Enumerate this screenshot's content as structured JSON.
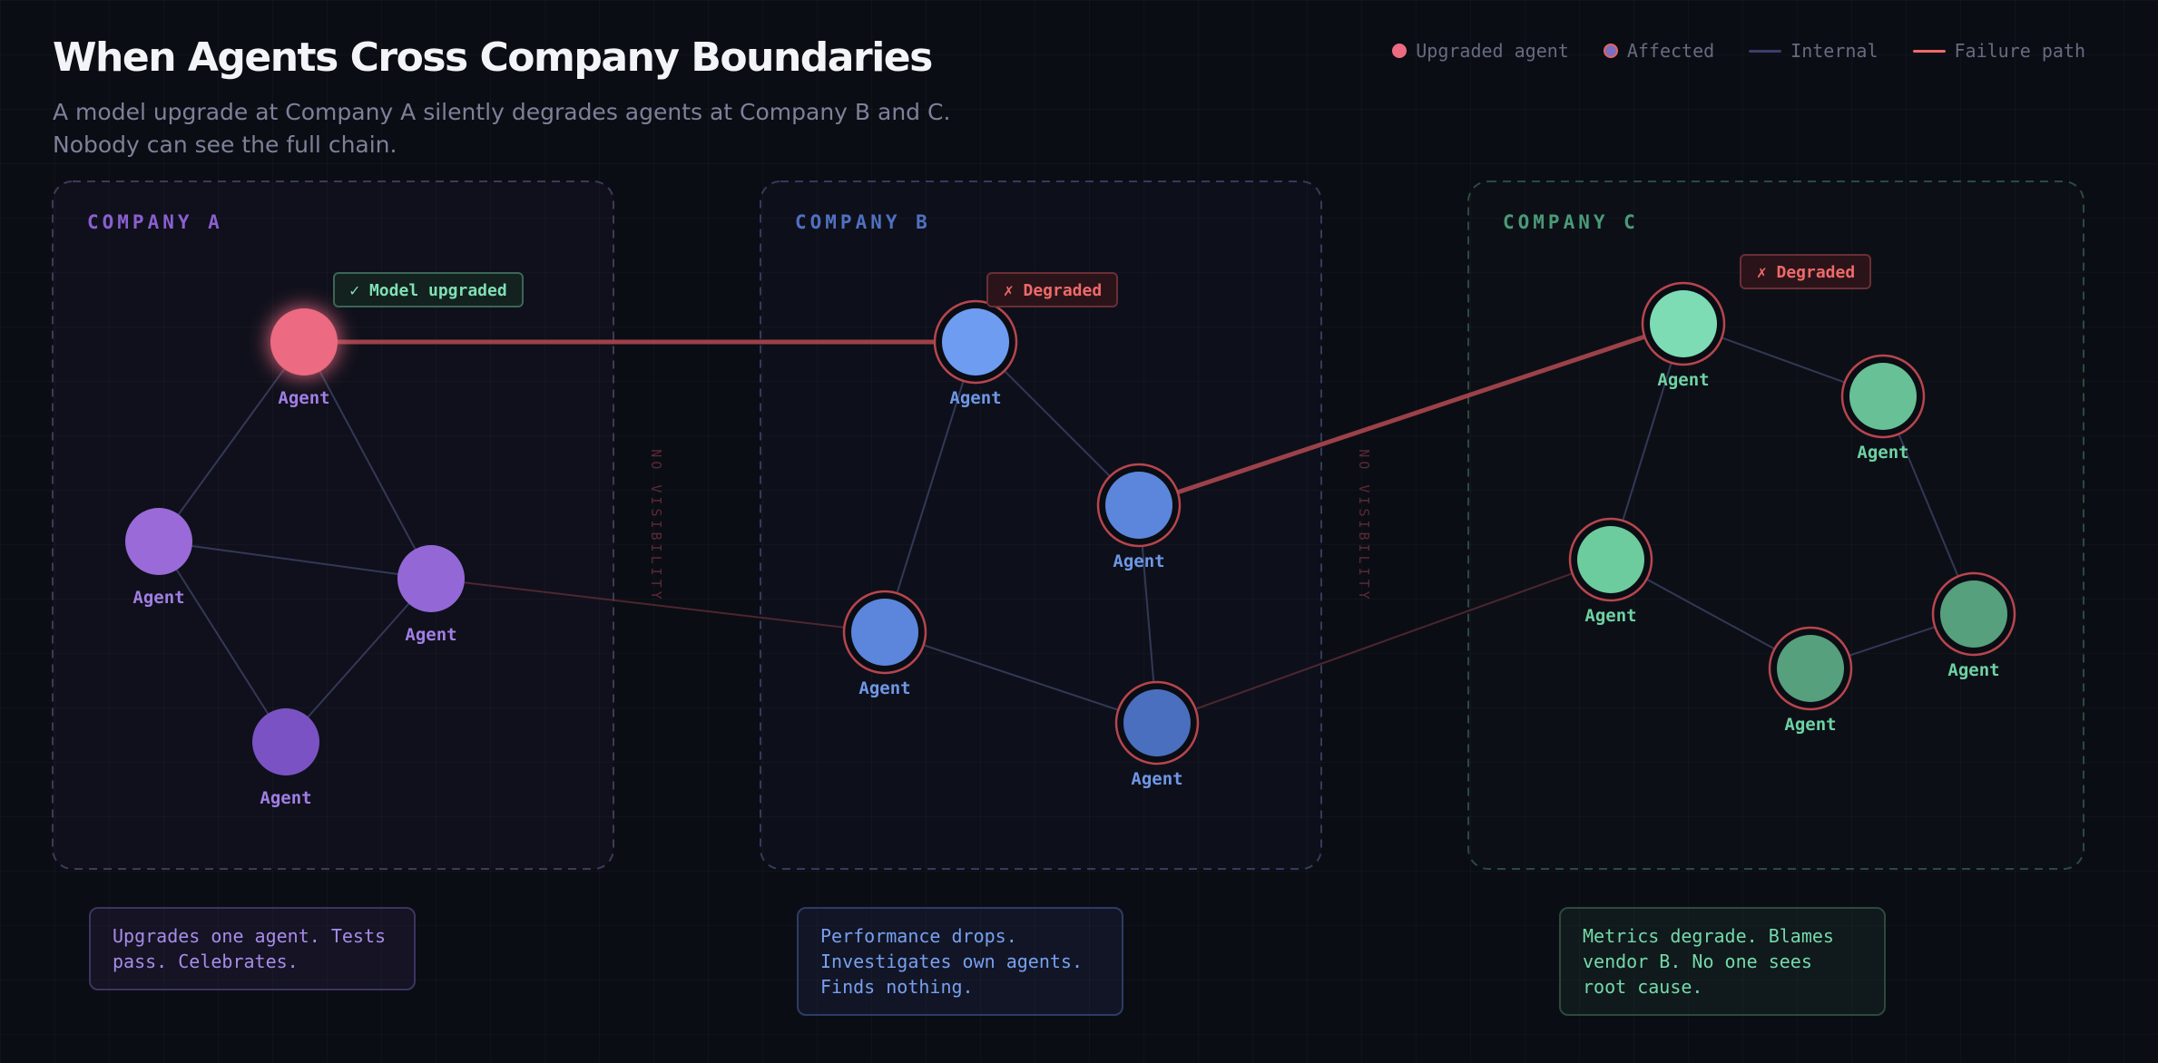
{
  "title": "When Agents Cross Company Boundaries",
  "subtitle": "A model upgrade at Company A silently degrades agents at Company B and C. Nobody can see the full chain.",
  "legend": {
    "upgraded": "Upgraded agent",
    "affected": "Affected",
    "internal": "Internal",
    "failure": "Failure path"
  },
  "colors": {
    "upgraded": "#ec6b82",
    "failure": "#e06464",
    "companyA": "#9b6ddb",
    "companyB": "#5f8be0",
    "companyC": "#5fc898",
    "ok_badge": "#7fe0b4"
  },
  "companies": [
    {
      "id": "A",
      "label": "COMPANY A",
      "note": "Upgrades one agent. Tests pass. Celebrates."
    },
    {
      "id": "B",
      "label": "COMPANY B",
      "note": "Performance drops. Investigates own agents. Finds nothing."
    },
    {
      "id": "C",
      "label": "COMPANY C",
      "note": "Metrics degrade. Blames vendor B. No one sees root cause."
    }
  ],
  "visibility_label": "NO VISIBILITY",
  "badges": {
    "upgraded": "✓ Model upgraded",
    "degraded_b": "✗ Degraded",
    "degraded_c": "✗ Degraded"
  },
  "agents": [
    {
      "id": "a1",
      "company": "A",
      "label": "Agent",
      "state": "upgraded"
    },
    {
      "id": "a2",
      "company": "A",
      "label": "Agent",
      "state": "normal"
    },
    {
      "id": "a3",
      "company": "A",
      "label": "Agent",
      "state": "normal"
    },
    {
      "id": "a4",
      "company": "A",
      "label": "Agent",
      "state": "normal"
    },
    {
      "id": "b1",
      "company": "B",
      "label": "Agent",
      "state": "affected"
    },
    {
      "id": "b2",
      "company": "B",
      "label": "Agent",
      "state": "affected"
    },
    {
      "id": "b3",
      "company": "B",
      "label": "Agent",
      "state": "affected"
    },
    {
      "id": "b4",
      "company": "B",
      "label": "Agent",
      "state": "affected"
    },
    {
      "id": "c1",
      "company": "C",
      "label": "Agent",
      "state": "affected"
    },
    {
      "id": "c2",
      "company": "C",
      "label": "Agent",
      "state": "affected"
    },
    {
      "id": "c3",
      "company": "C",
      "label": "Agent",
      "state": "affected"
    },
    {
      "id": "c4",
      "company": "C",
      "label": "Agent",
      "state": "affected"
    },
    {
      "id": "c5",
      "company": "C",
      "label": "Agent",
      "state": "affected"
    }
  ],
  "edges": [
    {
      "from": "a1",
      "to": "a2",
      "kind": "internal"
    },
    {
      "from": "a1",
      "to": "a3",
      "kind": "internal"
    },
    {
      "from": "a2",
      "to": "a3",
      "kind": "internal"
    },
    {
      "from": "a2",
      "to": "a4",
      "kind": "internal"
    },
    {
      "from": "a3",
      "to": "a4",
      "kind": "internal"
    },
    {
      "from": "b1",
      "to": "b2",
      "kind": "internal"
    },
    {
      "from": "b1",
      "to": "b3",
      "kind": "internal"
    },
    {
      "from": "b3",
      "to": "b4",
      "kind": "internal"
    },
    {
      "from": "b2",
      "to": "b4",
      "kind": "internal"
    },
    {
      "from": "c1",
      "to": "c2",
      "kind": "internal"
    },
    {
      "from": "c1",
      "to": "c3",
      "kind": "internal"
    },
    {
      "from": "c3",
      "to": "c4",
      "kind": "internal"
    },
    {
      "from": "c2",
      "to": "c5",
      "kind": "internal"
    },
    {
      "from": "c4",
      "to": "c5",
      "kind": "internal"
    },
    {
      "from": "a1",
      "to": "b1",
      "kind": "failure"
    },
    {
      "from": "b2",
      "to": "c1",
      "kind": "failure"
    },
    {
      "from": "a3",
      "to": "b3",
      "kind": "cross"
    },
    {
      "from": "b4",
      "to": "c3",
      "kind": "cross"
    }
  ]
}
